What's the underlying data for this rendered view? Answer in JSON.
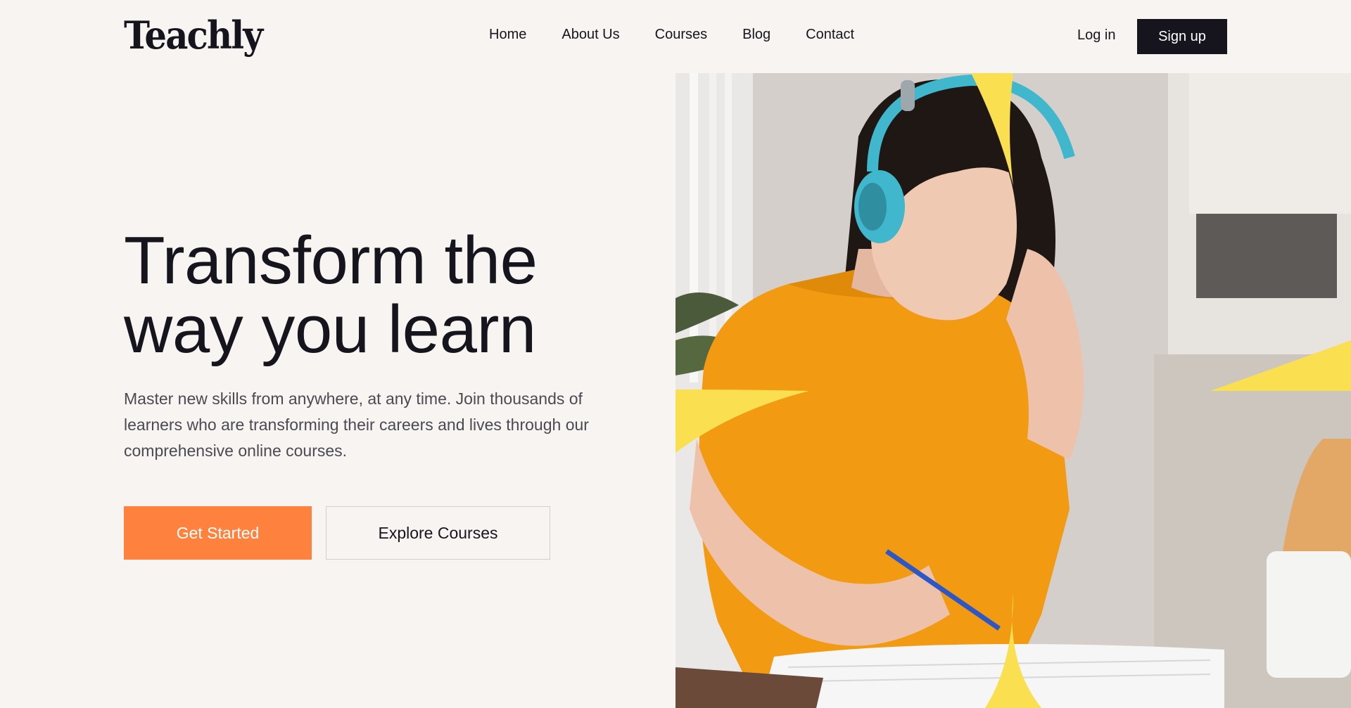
{
  "header": {
    "logo": "Teachly",
    "nav": [
      "Home",
      "About Us",
      "Courses",
      "Blog",
      "Contact"
    ],
    "login_label": "Log in",
    "signup_label": "Sign up"
  },
  "hero": {
    "title_line1": "Transform the",
    "title_line2": "way you learn",
    "description": "Master new skills from anywhere, at any time. Join thousands of learners who are transforming their careers and lives through our comprehensive online courses.",
    "primary_button": "Get Started",
    "secondary_button": "Explore Courses",
    "image": "student-with-headphones-writing-photo"
  },
  "colors": {
    "background": "#f7f4f1",
    "text": "#16151d",
    "primary": "#fe813d",
    "dark_button": "#16151d",
    "accent_yellow": "#fadf50",
    "shirt": "#f19a12",
    "headphones": "#40b7cc"
  }
}
